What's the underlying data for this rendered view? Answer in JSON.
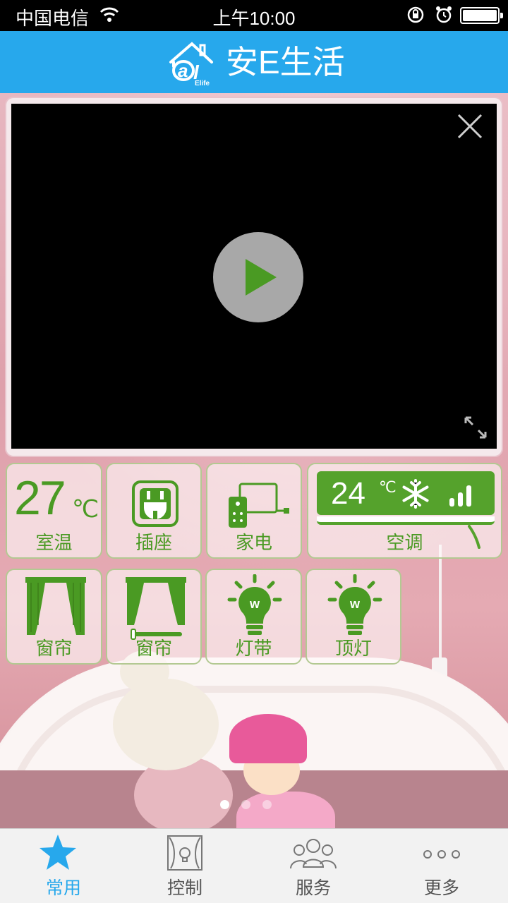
{
  "status_bar": {
    "carrier": "中国电信",
    "time": "上午10:00",
    "battery_level": 1.0,
    "icons": [
      "wifi-icon",
      "rotation-lock-icon",
      "alarm-icon",
      "battery-icon"
    ]
  },
  "header": {
    "title": "安E生活",
    "logo_text": "Elife",
    "background_color": "#27a8ec"
  },
  "video_player": {
    "state": "paused",
    "icons": [
      "close-icon",
      "play-icon",
      "fullscreen-icon"
    ]
  },
  "tiles": [
    {
      "id": "room-temperature",
      "label": "室温",
      "value": "27",
      "unit": "℃"
    },
    {
      "id": "socket",
      "label": "插座",
      "icon": "socket-icon"
    },
    {
      "id": "appliance",
      "label": "家电",
      "icon": "appliance-icon"
    },
    {
      "id": "air-conditioner",
      "label": "空调",
      "value": "24",
      "unit": "℃",
      "mode_icon": "snowflake-icon",
      "signal_bars": 3
    },
    {
      "id": "curtain-1",
      "label": "窗帘",
      "icon": "curtain-icon"
    },
    {
      "id": "curtain-2",
      "label": "窗帘",
      "icon": "curtain-icon"
    },
    {
      "id": "light-strip",
      "label": "灯带",
      "icon": "bulb-icon",
      "icon_letter": "w"
    },
    {
      "id": "ceiling-light",
      "label": "顶灯",
      "icon": "bulb-icon",
      "icon_letter": "w"
    }
  ],
  "page_indicator": {
    "count": 3,
    "active": 1
  },
  "tab_bar": {
    "tabs": [
      {
        "label": "常用",
        "icon": "star-icon",
        "active": true
      },
      {
        "label": "控制",
        "icon": "control-icon",
        "active": false
      },
      {
        "label": "服务",
        "icon": "people-icon",
        "active": false
      },
      {
        "label": "更多",
        "icon": "more-icon",
        "active": false
      }
    ]
  },
  "colors": {
    "accent_green": "#4a9a23",
    "tab_active": "#27a8ec",
    "tile_border": "#b3c992"
  }
}
